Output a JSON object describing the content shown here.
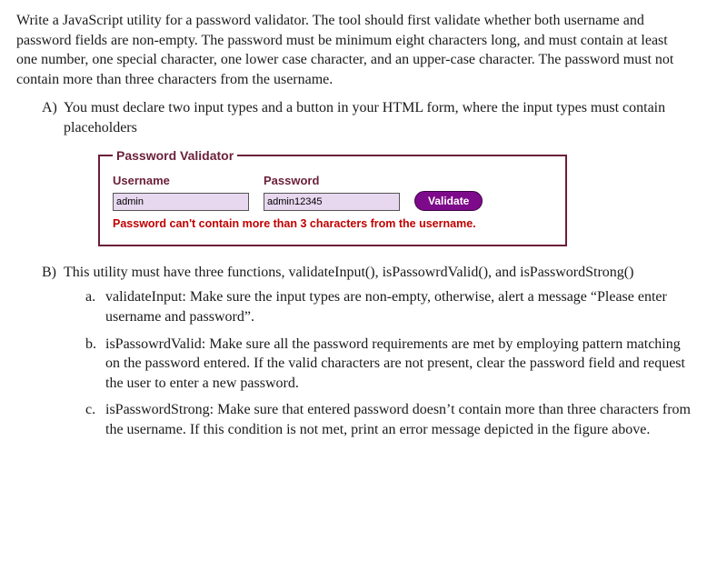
{
  "intro": "Write a JavaScript utility for a password validator. The tool should first validate whether both username and password fields are non-empty. The password must be minimum eight characters long, and must contain at least one number, one special character, one lower case character, and an upper-case character. The password must not contain more than three characters from the username.",
  "items": {
    "A": {
      "label": "A)",
      "text": "You must declare two input types and a button in your HTML form, where the input types must contain placeholders"
    },
    "B": {
      "label": "B)",
      "text": "This utility must have three functions, validateInput(), isPassowrdValid(), and isPasswordStrong()",
      "sub": {
        "a": {
          "label": "a.",
          "text": "validateInput: Make sure the input types are non-empty, otherwise, alert a message “Please enter username and password”."
        },
        "b": {
          "label": "b.",
          "text": "isPassowrdValid: Make sure all the password requirements are met by employing pattern matching on the password entered. If the valid characters are not present, clear the password field and request the user to enter a new password."
        },
        "c": {
          "label": "c.",
          "text": "isPasswordStrong: Make sure that entered password doesn’t contain more than three characters from the username. If this condition is not met, print an error message depicted in the figure above."
        }
      }
    }
  },
  "form": {
    "legend": "Password Validator",
    "username_label": "Username",
    "password_label": "Password",
    "username_value": "admin",
    "password_value": "admin12345",
    "username_placeholder": "admin",
    "password_placeholder": "admin12345",
    "button_label": "Validate",
    "error_message": "Password can't contain more than 3 characters from the username."
  }
}
